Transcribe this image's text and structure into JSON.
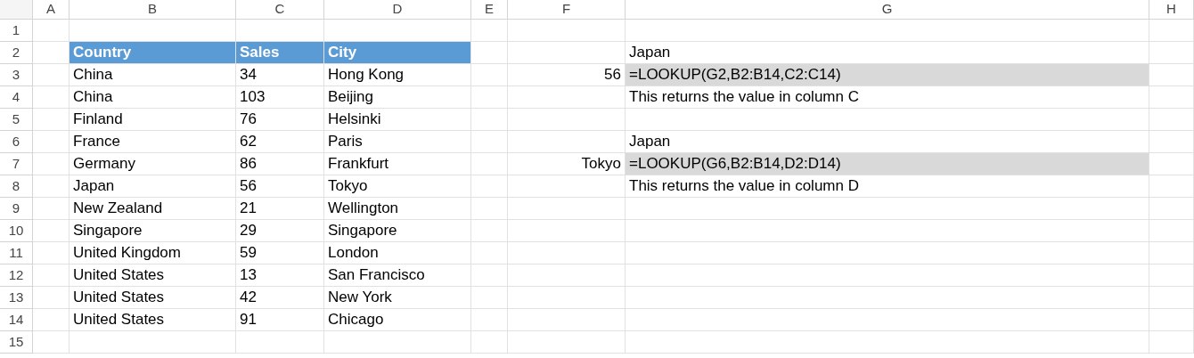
{
  "column_headers": [
    "A",
    "B",
    "C",
    "D",
    "E",
    "F",
    "G",
    "H"
  ],
  "rows": [
    {
      "number": "1",
      "cells": [
        {
          "kind": "empty"
        },
        {
          "kind": "empty"
        },
        {
          "kind": "empty"
        },
        {
          "kind": "empty"
        },
        {
          "kind": "empty"
        },
        {
          "kind": "empty"
        },
        {
          "kind": "empty"
        },
        {
          "kind": "empty"
        }
      ]
    },
    {
      "number": "2",
      "cells": [
        {
          "kind": "empty"
        },
        {
          "kind": "header",
          "text": "Country"
        },
        {
          "kind": "header",
          "text": "Sales"
        },
        {
          "kind": "header",
          "text": "City"
        },
        {
          "kind": "empty"
        },
        {
          "kind": "empty"
        },
        {
          "kind": "text",
          "text": "Japan"
        },
        {
          "kind": "empty"
        }
      ]
    },
    {
      "number": "3",
      "cells": [
        {
          "kind": "empty"
        },
        {
          "kind": "text",
          "text": "China"
        },
        {
          "kind": "text",
          "text": "34"
        },
        {
          "kind": "text",
          "text": "Hong Kong"
        },
        {
          "kind": "empty"
        },
        {
          "kind": "number",
          "text": "56"
        },
        {
          "kind": "formula",
          "text": "=LOOKUP(G2,B2:B14,C2:C14)"
        },
        {
          "kind": "empty"
        }
      ]
    },
    {
      "number": "4",
      "cells": [
        {
          "kind": "empty"
        },
        {
          "kind": "text",
          "text": "China"
        },
        {
          "kind": "text",
          "text": "103"
        },
        {
          "kind": "text",
          "text": "Beijing"
        },
        {
          "kind": "empty"
        },
        {
          "kind": "empty"
        },
        {
          "kind": "text",
          "text": "This returns the value in column C"
        },
        {
          "kind": "empty"
        }
      ]
    },
    {
      "number": "5",
      "cells": [
        {
          "kind": "empty"
        },
        {
          "kind": "text",
          "text": "Finland"
        },
        {
          "kind": "text",
          "text": "76"
        },
        {
          "kind": "text",
          "text": "Helsinki"
        },
        {
          "kind": "empty"
        },
        {
          "kind": "empty"
        },
        {
          "kind": "empty"
        },
        {
          "kind": "empty"
        }
      ]
    },
    {
      "number": "6",
      "cells": [
        {
          "kind": "empty"
        },
        {
          "kind": "text",
          "text": "France"
        },
        {
          "kind": "text",
          "text": "62"
        },
        {
          "kind": "text",
          "text": "Paris"
        },
        {
          "kind": "empty"
        },
        {
          "kind": "empty"
        },
        {
          "kind": "text",
          "text": "Japan"
        },
        {
          "kind": "empty"
        }
      ]
    },
    {
      "number": "7",
      "cells": [
        {
          "kind": "empty"
        },
        {
          "kind": "text",
          "text": "Germany"
        },
        {
          "kind": "text",
          "text": "86"
        },
        {
          "kind": "text",
          "text": "Frankfurt"
        },
        {
          "kind": "empty"
        },
        {
          "kind": "number",
          "text": "Tokyo"
        },
        {
          "kind": "formula",
          "text": "=LOOKUP(G6,B2:B14,D2:D14)"
        },
        {
          "kind": "empty"
        }
      ]
    },
    {
      "number": "8",
      "cells": [
        {
          "kind": "empty"
        },
        {
          "kind": "text",
          "text": "Japan"
        },
        {
          "kind": "text",
          "text": "56"
        },
        {
          "kind": "text",
          "text": "Tokyo"
        },
        {
          "kind": "empty"
        },
        {
          "kind": "empty"
        },
        {
          "kind": "text",
          "text": "This returns the value in column D"
        },
        {
          "kind": "empty"
        }
      ]
    },
    {
      "number": "9",
      "cells": [
        {
          "kind": "empty"
        },
        {
          "kind": "text",
          "text": "New Zealand"
        },
        {
          "kind": "text",
          "text": "21"
        },
        {
          "kind": "text",
          "text": "Wellington"
        },
        {
          "kind": "empty"
        },
        {
          "kind": "empty"
        },
        {
          "kind": "empty"
        },
        {
          "kind": "empty"
        }
      ]
    },
    {
      "number": "10",
      "cells": [
        {
          "kind": "empty"
        },
        {
          "kind": "text",
          "text": "Singapore"
        },
        {
          "kind": "text",
          "text": "29"
        },
        {
          "kind": "text",
          "text": "Singapore"
        },
        {
          "kind": "empty"
        },
        {
          "kind": "empty"
        },
        {
          "kind": "empty"
        },
        {
          "kind": "empty"
        }
      ]
    },
    {
      "number": "11",
      "cells": [
        {
          "kind": "empty"
        },
        {
          "kind": "text",
          "text": "United Kingdom"
        },
        {
          "kind": "text",
          "text": "59"
        },
        {
          "kind": "text",
          "text": "London"
        },
        {
          "kind": "empty"
        },
        {
          "kind": "empty"
        },
        {
          "kind": "empty"
        },
        {
          "kind": "empty"
        }
      ]
    },
    {
      "number": "12",
      "cells": [
        {
          "kind": "empty"
        },
        {
          "kind": "text",
          "text": "United States"
        },
        {
          "kind": "text",
          "text": "13"
        },
        {
          "kind": "text",
          "text": "San Francisco"
        },
        {
          "kind": "empty"
        },
        {
          "kind": "empty"
        },
        {
          "kind": "empty"
        },
        {
          "kind": "empty"
        }
      ]
    },
    {
      "number": "13",
      "cells": [
        {
          "kind": "empty"
        },
        {
          "kind": "text",
          "text": "United States"
        },
        {
          "kind": "text",
          "text": "42"
        },
        {
          "kind": "text",
          "text": "New York"
        },
        {
          "kind": "empty"
        },
        {
          "kind": "empty"
        },
        {
          "kind": "empty"
        },
        {
          "kind": "empty"
        }
      ]
    },
    {
      "number": "14",
      "cells": [
        {
          "kind": "empty"
        },
        {
          "kind": "text",
          "text": "United States"
        },
        {
          "kind": "text",
          "text": "91"
        },
        {
          "kind": "text",
          "text": "Chicago"
        },
        {
          "kind": "empty"
        },
        {
          "kind": "empty"
        },
        {
          "kind": "empty"
        },
        {
          "kind": "empty"
        }
      ]
    },
    {
      "number": "15",
      "cells": [
        {
          "kind": "empty"
        },
        {
          "kind": "empty"
        },
        {
          "kind": "empty"
        },
        {
          "kind": "empty"
        },
        {
          "kind": "empty"
        },
        {
          "kind": "empty"
        },
        {
          "kind": "empty"
        },
        {
          "kind": "empty"
        }
      ]
    }
  ]
}
